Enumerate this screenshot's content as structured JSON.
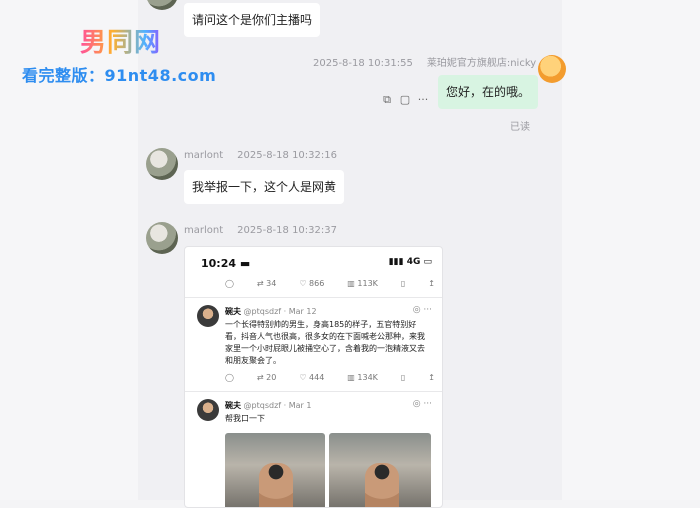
{
  "watermark": {
    "logo": "男同网",
    "url": "看完整版：91nt48.com"
  },
  "messages": [
    {
      "text": "请问这个是你们主播吗"
    },
    {
      "sender": "莱珀妮官方旗舰店:nicky",
      "time": "2025-8-18 10:31:55",
      "text": "您好，在的哦。",
      "status": "已读"
    },
    {
      "sender": "marlont",
      "time": "2025-8-18 10:32:16",
      "text": "我举报一下，这个人是网黄"
    },
    {
      "sender": "marlont",
      "time": "2025-8-18 10:32:37"
    }
  ],
  "toolbar_icons": [
    "copy-icon",
    "quote-icon",
    "more-icon"
  ],
  "toolbar_glyphs": [
    "⧉",
    "▢",
    "···"
  ],
  "screenshot": {
    "status_time": "10:24",
    "status_right": "4G",
    "top_actions": [
      "34",
      "866",
      "113K"
    ],
    "posts": [
      {
        "name": "碗夫",
        "handle": "@ptqsdzf · Mar 12",
        "text": "一个长得特别帅的男生，身高185的样子，五官特别好看，抖音人气也很高，很多女的在下面喊老公那种，来我家里一个小时屁眼儿被捅空心了，含着我的一泡精液又去和朋友聚会了。",
        "actions": [
          "20",
          "444",
          "134K"
        ]
      },
      {
        "name": "碗夫",
        "handle": "@ptqsdzf · Mar 1",
        "text": "帮我口一下"
      }
    ]
  }
}
